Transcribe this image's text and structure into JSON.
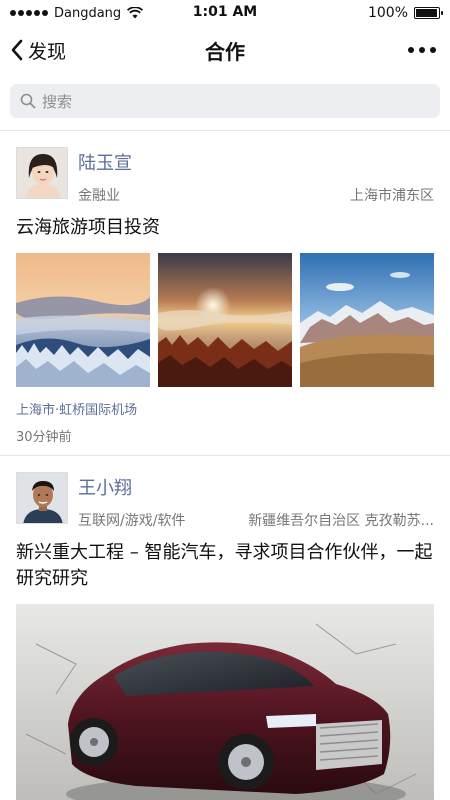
{
  "status_bar": {
    "carrier": "Dangdang",
    "time": "1:01 AM",
    "battery": "100%",
    "battery_level": 1.0
  },
  "nav": {
    "back_label": "发现",
    "title": "合作"
  },
  "search": {
    "placeholder": "搜索"
  },
  "posts": [
    {
      "name": "陆玉宣",
      "industry": "金融业",
      "location": "上海市浦东区",
      "text": "云海旅游项目投资",
      "place": "上海市·虹桥国际机场",
      "time": "30分钟前"
    },
    {
      "name": "王小翔",
      "industry": "互联网/游戏/软件",
      "location": "新疆维吾尔自治区 克孜勒苏...",
      "text": "新兴重大工程 – 智能汽车，寻求项目合作伙伴，一起研究研究"
    }
  ]
}
